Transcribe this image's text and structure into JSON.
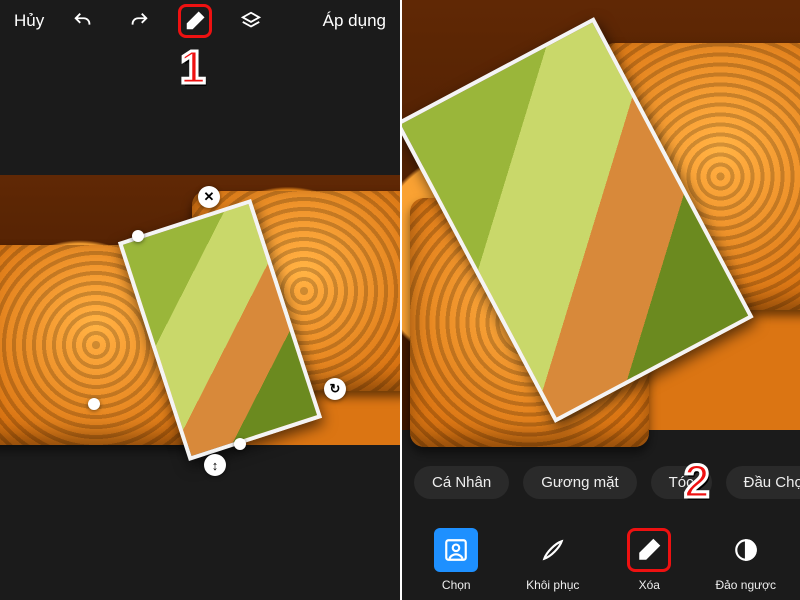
{
  "left": {
    "topbar": {
      "cancel": "Hủy",
      "apply": "Áp dụng"
    },
    "icons": {
      "undo": "undo-icon",
      "redo": "redo-icon",
      "eraser": "eraser-icon",
      "layers": "layers-icon"
    },
    "handles": {
      "close": "✕",
      "rotate": "↻",
      "flip": "↕"
    }
  },
  "right": {
    "chips": [
      "Cá Nhân",
      "Gương mặt",
      "Tóc",
      "Đầu Chọn"
    ],
    "tools": [
      {
        "key": "select",
        "label": "Chọn"
      },
      {
        "key": "restore",
        "label": "Khôi phục"
      },
      {
        "key": "erase",
        "label": "Xóa"
      },
      {
        "key": "invert",
        "label": "Đảo ngược"
      }
    ]
  },
  "callouts": {
    "step1": "1",
    "step2": "2"
  },
  "colors": {
    "highlight": "#e11d1d",
    "accent": "#1e90ff"
  }
}
